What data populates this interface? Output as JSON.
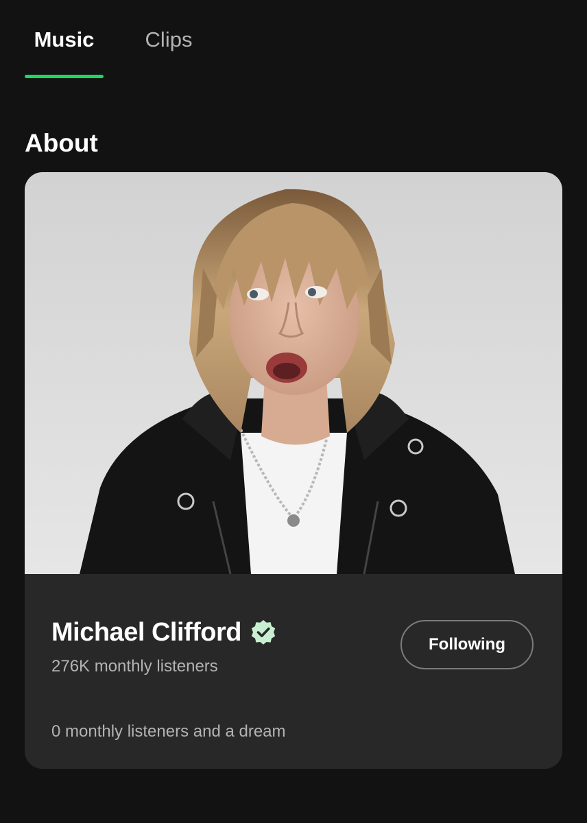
{
  "tabs": [
    {
      "label": "Music",
      "active": true
    },
    {
      "label": "Clips",
      "active": false
    }
  ],
  "about": {
    "title": "About"
  },
  "artist": {
    "name": "Michael Clifford",
    "verified": true,
    "monthly_listeners": "276K monthly listeners",
    "follow_label": "Following",
    "bio": "0 monthly listeners and a dream",
    "photo_icon": "artist-photo"
  },
  "colors": {
    "background": "#121212",
    "card": "#282828",
    "accent": "#1ed760",
    "verified_badge": "#c8efd1",
    "secondary_text": "#b3b3b3"
  }
}
